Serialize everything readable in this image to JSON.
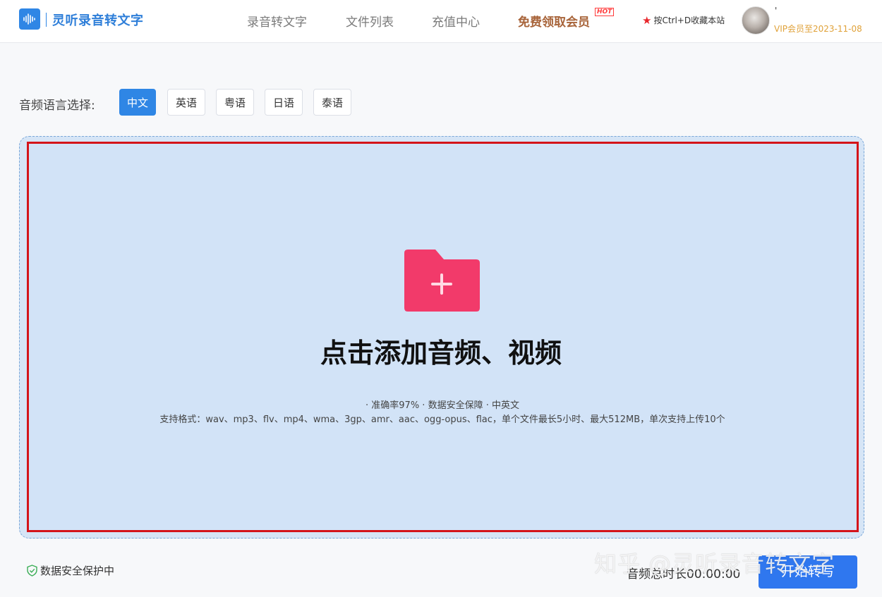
{
  "header": {
    "brand": "灵听录音转文字",
    "nav": [
      "录音转文字",
      "文件列表",
      "充值中心"
    ],
    "member_label": "免费领取会员",
    "hot_badge": "HOT",
    "bookmark": "按Ctrl+D收藏本站",
    "username": "' ",
    "vip_expire": "VIP会员至2023-11-08"
  },
  "language": {
    "label": "音频语言选择:",
    "options": [
      "中文",
      "英语",
      "粤语",
      "日语",
      "泰语"
    ],
    "selected": "中文"
  },
  "upload": {
    "title": "点击添加音频、视频",
    "features": "· 准确率97%   · 数据安全保障   · 中英文",
    "formats": "支持格式：wav、mp3、flv、mp4、wma、3gp、amr、aac、ogg-opus、flac，单个文件最长5小时、最大512MB，单次支持上传10个"
  },
  "footer": {
    "secure_text": "数据安全保护中",
    "duration": "音频总时长00:00:00",
    "start_button": "开始转写"
  },
  "watermark": "知乎 @灵听录音转文字",
  "colors": {
    "primary": "#2f86e5",
    "folder": "#f23a6a",
    "upload_bg": "#d2e3f7",
    "highlight_border": "#d4141a",
    "member": "#a8643a",
    "vip": "#e0a23a"
  }
}
